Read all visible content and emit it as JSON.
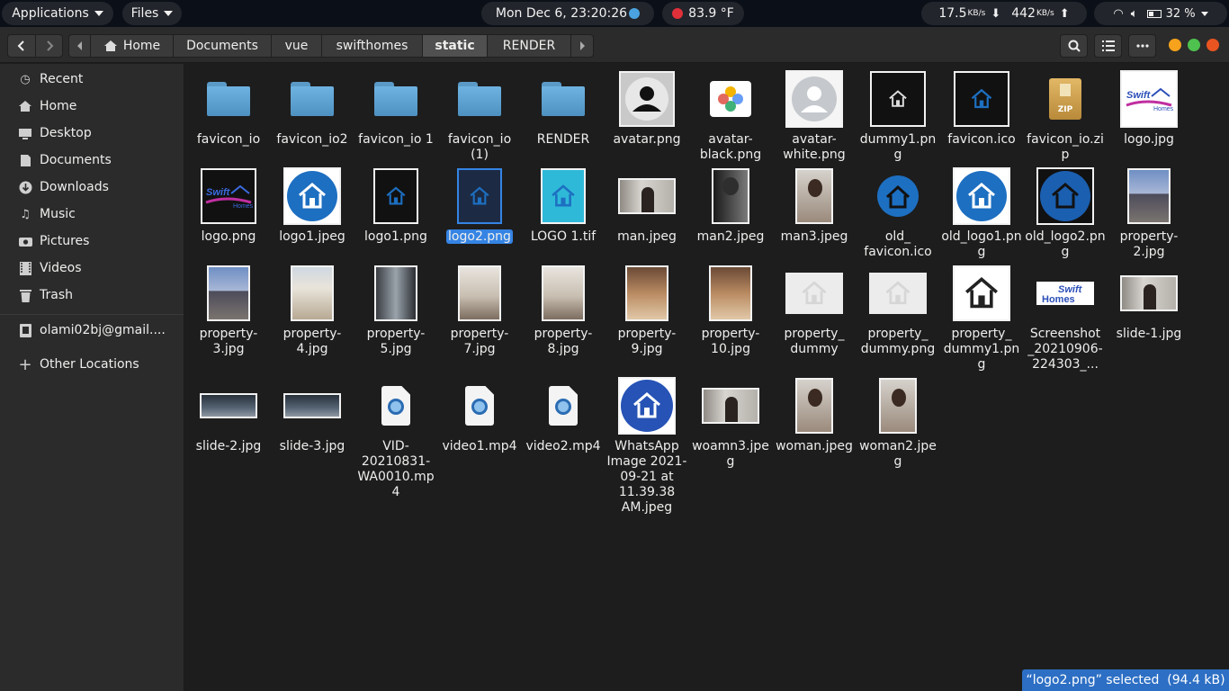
{
  "topbar": {
    "applications": "Applications",
    "files_menu": "Files",
    "clock": "Mon Dec  6, 23:20:26",
    "weather": "83.9 °F",
    "net_down": "17.5",
    "net_down_unit": "KB/s",
    "net_up": "442",
    "net_up_unit": "KB/s",
    "battery": "32 %"
  },
  "pathbar": {
    "crumbs": [
      "Home",
      "Documents",
      "vue",
      "swifthomes",
      "static",
      "RENDER"
    ],
    "active_index": 4
  },
  "sidebar": {
    "items": [
      {
        "label": "Recent",
        "icon": "clock-icon"
      },
      {
        "label": "Home",
        "icon": "home-icon"
      },
      {
        "label": "Desktop",
        "icon": "desktop-icon"
      },
      {
        "label": "Documents",
        "icon": "documents-icon"
      },
      {
        "label": "Downloads",
        "icon": "downloads-icon"
      },
      {
        "label": "Music",
        "icon": "music-icon"
      },
      {
        "label": "Pictures",
        "icon": "pictures-icon"
      },
      {
        "label": "Videos",
        "icon": "videos-icon"
      },
      {
        "label": "Trash",
        "icon": "trash-icon"
      },
      {
        "label": "olami02bj@gmail....",
        "icon": "account-icon"
      },
      {
        "label": "Other Locations",
        "icon": "plus-icon"
      }
    ]
  },
  "files": [
    {
      "name": "favicon_io",
      "kind": "folder"
    },
    {
      "name": "favicon_io2",
      "kind": "folder"
    },
    {
      "name": "favicon_io 1",
      "kind": "folder"
    },
    {
      "name": "favicon_io (1)",
      "kind": "folder"
    },
    {
      "name": "RENDER",
      "kind": "folder"
    },
    {
      "name": "avatar.png",
      "kind": "avatar-dark"
    },
    {
      "name": "avatar-black.png",
      "kind": "photos-app"
    },
    {
      "name": "avatar-white.png",
      "kind": "avatar-light"
    },
    {
      "name": "dummy1.png",
      "kind": "logo-dark"
    },
    {
      "name": "favicon.ico",
      "kind": "logo-dark-blue"
    },
    {
      "name": "favicon_io.zip",
      "kind": "zip"
    },
    {
      "name": "logo.jpg",
      "kind": "swift-logo"
    },
    {
      "name": "logo.png",
      "kind": "swift-logo-dark"
    },
    {
      "name": "logo1.jpeg",
      "kind": "house-blue-circle"
    },
    {
      "name": "logo1.png",
      "kind": "logo-dark-blue-tall"
    },
    {
      "name": "logo2.png",
      "kind": "logo-dark-blue-tall",
      "selected": true
    },
    {
      "name": "LOGO 1.tif",
      "kind": "logo-cyan"
    },
    {
      "name": "man.jpeg",
      "kind": "photo-wide"
    },
    {
      "name": "man2.jpeg",
      "kind": "photo-bw"
    },
    {
      "name": "man3.jpeg",
      "kind": "photo-tall"
    },
    {
      "name": "old_ favicon.ico",
      "kind": "house-blue-circle-sm"
    },
    {
      "name": "old_logo1.png",
      "kind": "house-blue-circle"
    },
    {
      "name": "old_logo2.png",
      "kind": "house-dark-circle"
    },
    {
      "name": "property-2.jpg",
      "kind": "house-photo"
    },
    {
      "name": "property-3.jpg",
      "kind": "house-photo"
    },
    {
      "name": "property-4.jpg",
      "kind": "house-photo-light"
    },
    {
      "name": "property-5.jpg",
      "kind": "house-photo-modern"
    },
    {
      "name": "property-7.jpg",
      "kind": "interior-photo"
    },
    {
      "name": "property-8.jpg",
      "kind": "interior-photo"
    },
    {
      "name": "property-9.jpg",
      "kind": "interior-photo-warm"
    },
    {
      "name": "property-10.jpg",
      "kind": "interior-photo-warm"
    },
    {
      "name": "property_ dummy",
      "kind": "house-faint"
    },
    {
      "name": "property_ dummy.png",
      "kind": "house-faint"
    },
    {
      "name": "property_ dummy1.png",
      "kind": "house-outline"
    },
    {
      "name": "Screenshot _20210906-224303_...",
      "kind": "swift-banner"
    },
    {
      "name": "slide-1.jpg",
      "kind": "photo-wide"
    },
    {
      "name": "slide-2.jpg",
      "kind": "photo-wide-flat"
    },
    {
      "name": "slide-3.jpg",
      "kind": "photo-wide-flat"
    },
    {
      "name": "VID-20210831-WA0010.mp4",
      "kind": "video"
    },
    {
      "name": "video1.mp4",
      "kind": "video"
    },
    {
      "name": "video2.mp4",
      "kind": "video"
    },
    {
      "name": "WhatsApp Image 2021-09-21 at 11.39.38 AM.jpeg",
      "kind": "house-blue-square"
    },
    {
      "name": "woamn3.jpeg",
      "kind": "photo-wide"
    },
    {
      "name": "woman.jpeg",
      "kind": "photo-tall"
    },
    {
      "name": "woman2.jpeg",
      "kind": "photo-tall"
    }
  ],
  "status": {
    "text": "“logo2.png” selected  (94.4 kB)"
  },
  "colors": {
    "accent": "#3584e4",
    "folder": "#5ea4d5",
    "logo_blue": "#1d6fc1",
    "close": "#e95420"
  }
}
